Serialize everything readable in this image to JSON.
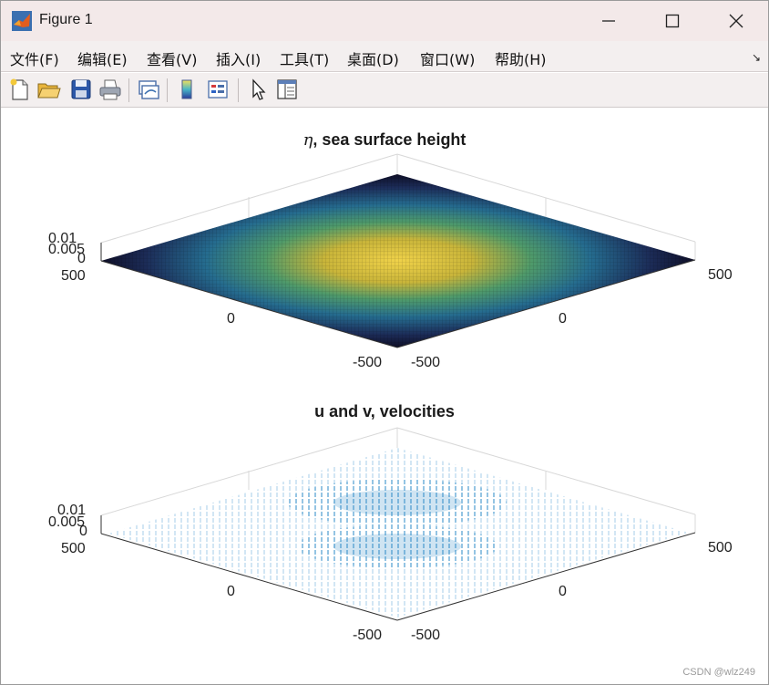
{
  "window": {
    "title": "Figure 1"
  },
  "menu": {
    "items": [
      {
        "label": "文件(F)"
      },
      {
        "label": "编辑(E)"
      },
      {
        "label": "查看(V)"
      },
      {
        "label": "插入(I)"
      },
      {
        "label": "工具(T)"
      },
      {
        "label": "桌面(D)"
      },
      {
        "label": "窗口(W)"
      },
      {
        "label": "帮助(H)"
      }
    ],
    "dock_arrow": "↘"
  },
  "toolbar": {
    "buttons": [
      "new-figure-icon",
      "open-file-icon",
      "save-icon",
      "print-icon",
      "link-plot-icon",
      "colorbar-icon",
      "legend-icon",
      "pointer-icon",
      "property-inspector-icon"
    ]
  },
  "plots": [
    {
      "title_greek": "η",
      "title_rest": ", sea surface height",
      "z_ticks": [
        "0.01",
        "0.005",
        "0"
      ],
      "x_ticks": [
        "500",
        "0",
        "-500"
      ],
      "y_ticks": [
        "-500",
        "0",
        "500"
      ]
    },
    {
      "title": "u and v, velocities",
      "z_ticks": [
        "0.01",
        "0.005",
        "0"
      ],
      "x_ticks": [
        "500",
        "0",
        "-500"
      ],
      "y_ticks": [
        "-500",
        "0",
        "500"
      ]
    }
  ],
  "watermark": "CSDN @wlz249",
  "colors": {
    "titlebar": "#f3e9e9",
    "quiver": "#0072bd",
    "surface_dark": "#0d0d2a",
    "surface_hot": "#e6c23a"
  }
}
